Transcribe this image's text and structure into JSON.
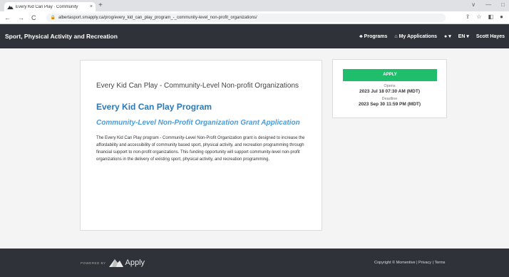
{
  "browser": {
    "tab_title": "Every Kid Can Play · Community",
    "tab_close": "×",
    "new_tab": "+",
    "url": "albertasport.smapply.ca/prog/every_kid_can_play_program_-_community-level_non-profit_organizations/",
    "window_controls": [
      "∨",
      "—",
      "□"
    ],
    "nav": [
      "←",
      "→",
      "C"
    ]
  },
  "header": {
    "brand": "Sport, Physical Activity and Recreation",
    "programs": "Programs",
    "my_applications": "My Applications",
    "help_caret": "▾",
    "language": "EN",
    "language_caret": "▾",
    "user": "Scott Hayes"
  },
  "card": {
    "title": "Every Kid Can Play - Community-Level Non-profit Organizations",
    "program_heading": "Every Kid Can Play Program",
    "subheading": "Community-Level Non-Profit Organization Grant Application",
    "description": "The Every Kid Can Play program - Community-Level Non-Profit Organization grant is designed to increase the affordability and accessibility of community based sport, physical activity, and recreation programming through financial support to non-profit organizations. This funding opportunity will support community-level non-profit organizations in the delivery of existing sport, physical activity, and recreation programming."
  },
  "side": {
    "apply": "APPLY",
    "opens_label": "Opens",
    "opens_value": "2023 Jul 18 07:30 AM (MDT)",
    "deadline_label": "Deadline",
    "deadline_value": "2023 Sep 30 11:59 PM (MDT)"
  },
  "footer": {
    "powered_by": "POWERED BY",
    "logo_text": "Apply",
    "copyright": "Copyright © Momentive | Privacy | Terms"
  },
  "colors": {
    "header_bg": "#2f3238",
    "apply_green": "#1fbe6b",
    "heading_blue": "#2a7ab8"
  }
}
